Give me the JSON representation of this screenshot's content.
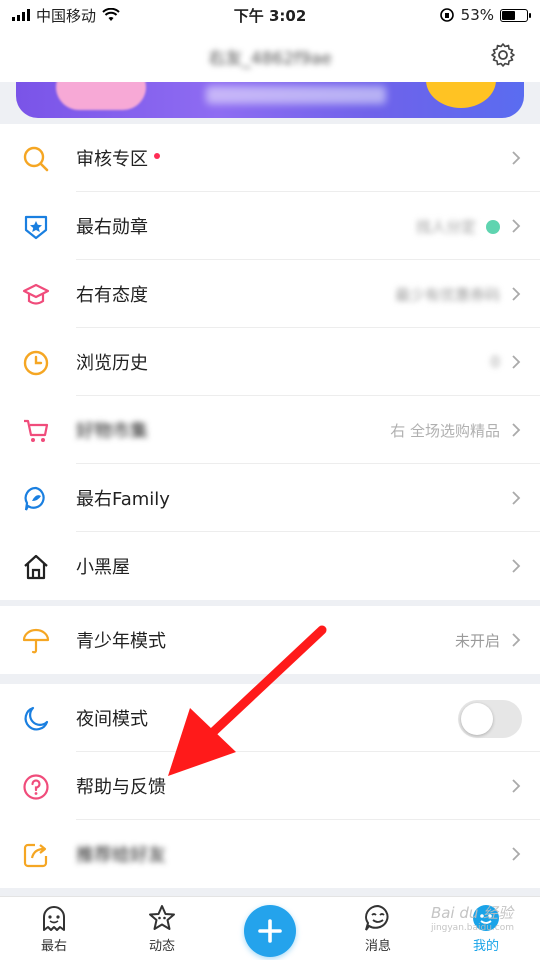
{
  "status_bar": {
    "carrier": "中国移动",
    "time": "下午 3:02",
    "battery": "53%",
    "battery_level": 0.53
  },
  "header": {
    "username": "右友_4862f9ae"
  },
  "menu_group1": [
    {
      "label": "审核专区",
      "icon": "magnifier-icon",
      "color": "#f5a623",
      "right": "",
      "badge": true
    },
    {
      "label": "最右勋章",
      "icon": "medal-icon",
      "color": "#1a7fe0",
      "right": "找人分定"
    },
    {
      "label": "右有态度",
      "icon": "graduation-cap-icon",
      "color": "#f04c7b",
      "right": "最少有优惠券码"
    },
    {
      "label": "浏览历史",
      "icon": "clock-icon",
      "color": "#f5a623",
      "right": "0"
    },
    {
      "label": "好物市集",
      "icon": "cart-icon",
      "color": "#f04c7b",
      "right": "右 全场选购精品"
    },
    {
      "label": "最右Family",
      "icon": "family-icon",
      "color": "#1a7fe0",
      "right": ""
    },
    {
      "label": "小黑屋",
      "icon": "house-icon",
      "color": "#222222",
      "right": ""
    }
  ],
  "menu_group2": [
    {
      "label": "青少年模式",
      "icon": "umbrella-icon",
      "color": "#f5a623",
      "right": "未开启"
    }
  ],
  "menu_group3": [
    {
      "label": "夜间模式",
      "icon": "moon-icon",
      "color": "#1a7fe0",
      "toggle": false
    },
    {
      "label": "帮助与反馈",
      "icon": "help-icon",
      "color": "#f04c7b"
    },
    {
      "label": "推荐给好友",
      "icon": "share-icon",
      "color": "#f5a623"
    }
  ],
  "tabbar": {
    "items": [
      {
        "label": "最右",
        "icon": "ghost-icon"
      },
      {
        "label": "动态",
        "icon": "star-icon"
      },
      {
        "label": "",
        "icon": "plus-icon"
      },
      {
        "label": "消息",
        "icon": "smile-icon"
      },
      {
        "label": "我的",
        "icon": "me-icon"
      }
    ]
  },
  "watermark": {
    "text": "Bai du 经验",
    "sub": "jingyan.baidu.com"
  },
  "colors": {
    "accent": "#24a3ec",
    "arrow": "#ff1a1a"
  }
}
